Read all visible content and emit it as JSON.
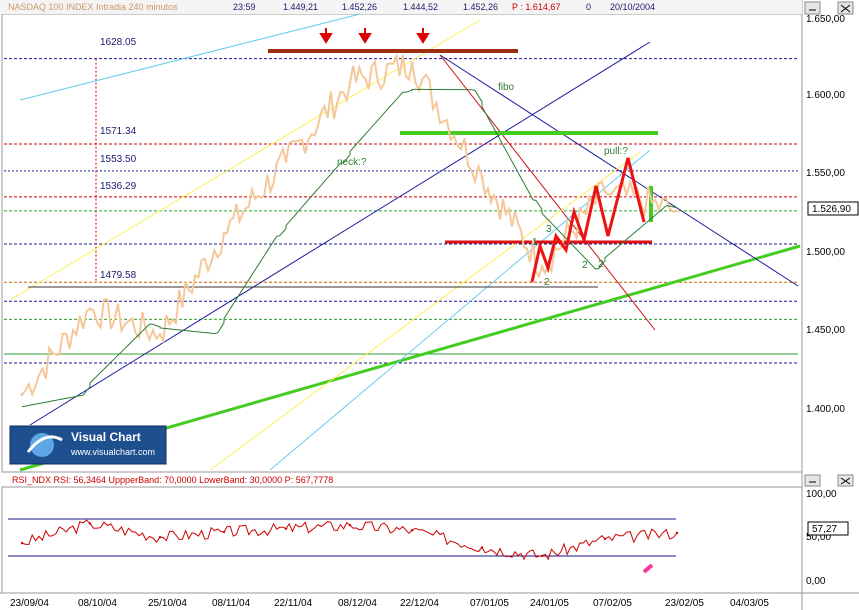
{
  "header": {
    "symbol_text": "NASDAQ 100 INDEX  Intradia 240 minutos",
    "time": "23:59",
    "open": "1.449,21",
    "high": "1.452,26",
    "low": "1.444,52",
    "close": "1.452,26",
    "p_value": "P : 1.614,67",
    "volume": "0",
    "date": "20/10/2004"
  },
  "logo": {
    "title": "Visual Chart",
    "url": "www.visualchart.com"
  },
  "price_axis": {
    "ticks": [
      "1.650,00",
      "1.600,00",
      "1.550,00",
      "1.500,00",
      "1.450,00",
      "1.400,00"
    ],
    "current_label": "1.526,90"
  },
  "levels": [
    {
      "value": 1628.05,
      "label": "1628.05"
    },
    {
      "value": 1571.34,
      "label": "1571.34"
    },
    {
      "value": 1553.5,
      "label": "1553.50"
    },
    {
      "value": 1536.29,
      "label": "1536.29"
    },
    {
      "value": 1479.58,
      "label": "1479.58"
    }
  ],
  "annotations": {
    "fibo": "fibo",
    "neck": "neck:?",
    "pull": "pull:?",
    "wave_labels": [
      "1",
      "2",
      "3",
      "2",
      "2"
    ]
  },
  "rsi": {
    "title": "RSI_NDX  RSI: 56,3464  UppperBand: 70,0000  LowerBand: 30,0000  P: 567,7778",
    "ticks": [
      "100,00",
      "50,00",
      "0,00"
    ],
    "current_label": "57,27"
  },
  "x_axis": {
    "dates": [
      "23/09/04",
      "08/10/04",
      "25/10/04",
      "08/11/04",
      "22/11/04",
      "08/12/04",
      "22/12/04",
      "07/01/05",
      "24/01/05",
      "07/02/05",
      "23/02/05",
      "04/03/05"
    ]
  },
  "colors": {
    "price_line": "#f5c89a",
    "moving_average": "#2e7d32",
    "rsi_line": "#cc0000",
    "trend_green": "#44cc22",
    "band_blue": "#1f1fa0",
    "resist_brown": "#9b2f10",
    "wave_red": "#ee1111"
  },
  "chart_data": {
    "type": "line",
    "x": [
      "23/09/04",
      "08/10/04",
      "25/10/04",
      "08/11/04",
      "22/11/04",
      "08/12/04",
      "22/12/04",
      "07/01/05",
      "24/01/05",
      "07/02/05",
      "23/02/05"
    ],
    "series": [
      {
        "values": [
          1405,
          1462,
          1445,
          1512,
          1560,
          1612,
          1625,
          1550,
          1490,
          1540,
          1527
        ]
      }
    ],
    "ylim": [
      1355,
      1655
    ],
    "rsi": {
      "values": [
        45,
        68,
        52,
        58,
        62,
        66,
        60,
        40,
        30,
        50,
        57
      ],
      "upper": 70,
      "lower": 30,
      "ylim": [
        -10,
        105
      ]
    }
  }
}
